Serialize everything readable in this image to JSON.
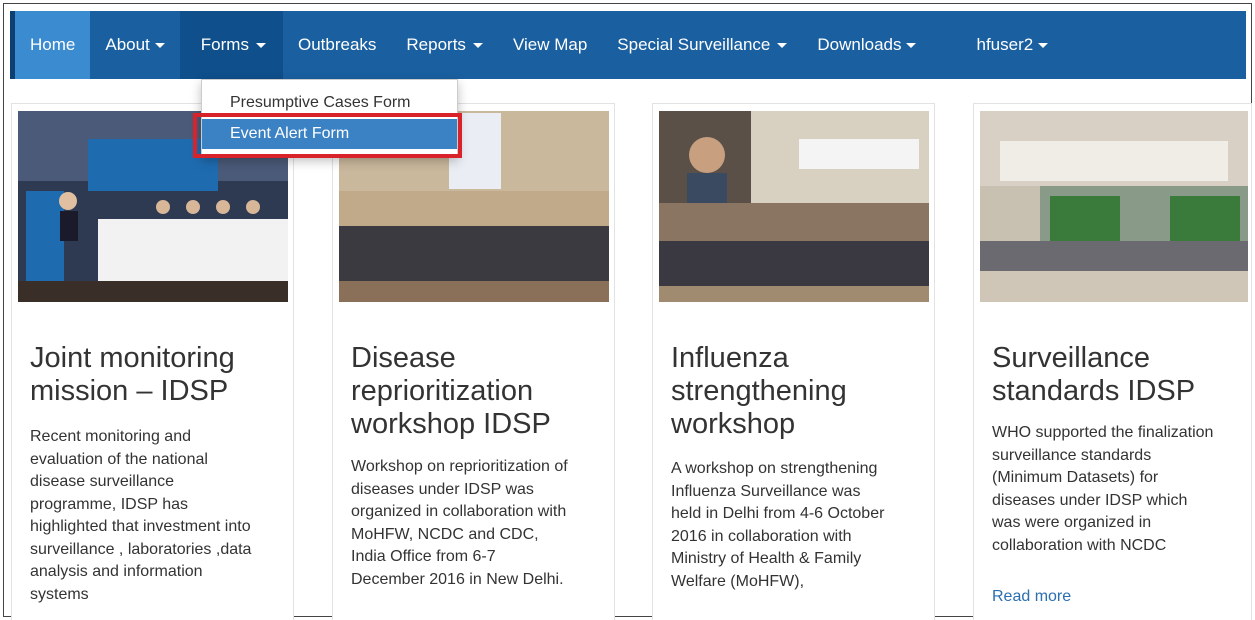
{
  "nav": {
    "home": "Home",
    "about": "About",
    "forms": "Forms",
    "outbreaks": "Outbreaks",
    "reports": "Reports",
    "view_map": "View Map",
    "special_surveillance": "Special Surveillance",
    "downloads": "Downloads",
    "user": "hfuser2"
  },
  "forms_menu": {
    "items": [
      "Presumptive Cases Form",
      "Event Alert Form"
    ],
    "highlighted": "Event Alert Form"
  },
  "cards": [
    {
      "title_lines": [
        "Joint monitoring",
        "mission – IDSP"
      ],
      "text_lines": [
        "Recent monitoring and",
        "evaluation of the national",
        "disease surveillance",
        "programme, IDSP has",
        "highlighted that investment into",
        "surveillance , laboratories ,data",
        "analysis and information",
        "systems"
      ]
    },
    {
      "title_lines": [
        "Disease",
        "reprioritization",
        "workshop IDSP"
      ],
      "text_lines": [
        "Workshop on reprioritization of",
        "diseases under IDSP was",
        "organized in collaboration with",
        "MoHFW, NCDC and CDC,",
        "India Office from 6-7",
        "December 2016 in New Delhi."
      ]
    },
    {
      "title_lines": [
        "Influenza",
        "strengthening",
        "workshop"
      ],
      "text_lines": [
        "A workshop on strengthening",
        "Influenza Surveillance was",
        "held in Delhi from 4-6 October",
        "2016 in collaboration with",
        "Ministry of Health & Family",
        "Welfare (MoHFW),"
      ]
    },
    {
      "title_lines": [
        "Surveillance",
        "standards IDSP"
      ],
      "text_lines": [
        "WHO supported the finalization",
        "surveillance standards",
        "(Minimum Datasets) for",
        "diseases under IDSP which",
        "was were organized in",
        "collaboration with NCDC"
      ],
      "link": "Read more"
    }
  ],
  "colors": {
    "navbar": "#1a5fa0",
    "nav_active": "#3b8bd0",
    "menu_highlight": "#3b82c4",
    "annotation_box": "#d8232a",
    "link": "#2a6fb0"
  }
}
